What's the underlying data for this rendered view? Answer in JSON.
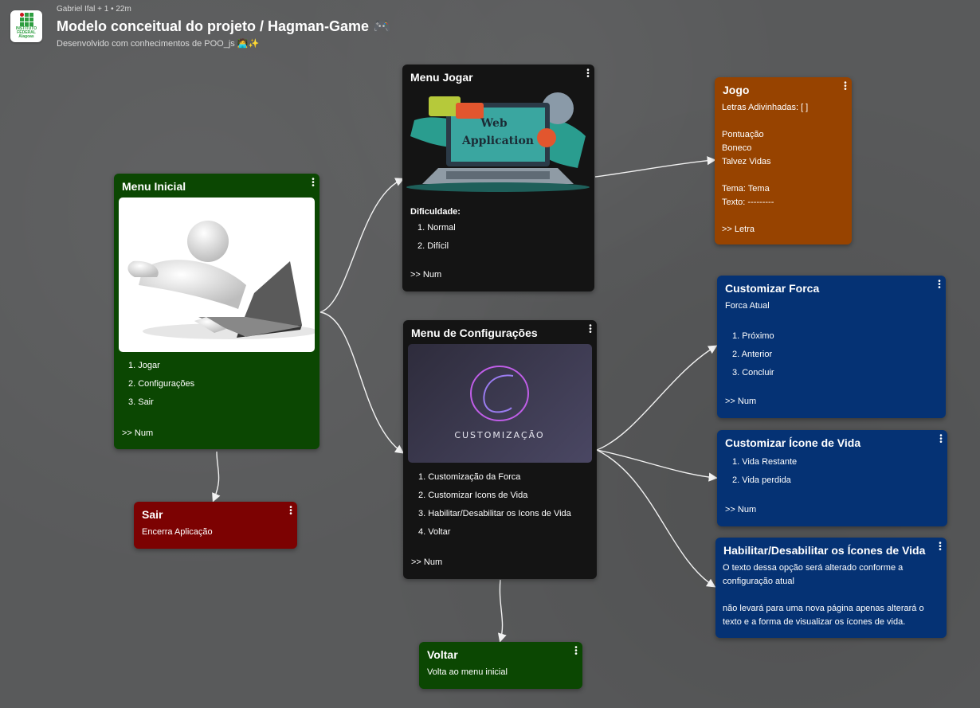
{
  "header": {
    "meta": "Gabriel Ifal + 1 •  22m",
    "title": "Modelo conceitual do projeto / Hagman-Game 🎮",
    "subtitle": "Desenvolvido com conhecimentos de POO_js 🧑‍💻✨",
    "logo_text": "INSTITUTO FEDERAL Alagoas"
  },
  "menu_inicial": {
    "title": "Menu Inicial",
    "items": [
      "1. Jogar",
      "2. Configurações",
      "3. Sair"
    ],
    "footer": ">> Num"
  },
  "sair": {
    "title": "Sair",
    "text": "Encerra Aplicação"
  },
  "menu_jogar": {
    "title": "Menu Jogar",
    "image_text_1": "Web",
    "image_text_2": "Application",
    "label": "Dificuldade:",
    "items": [
      "1. Normal",
      "2. Difícil"
    ],
    "footer": ">> Num"
  },
  "menu_config": {
    "title": "Menu de Configurações",
    "image_text": "CUSTOMIZAÇÃO",
    "items": [
      "1. Customização da Forca",
      "2. Customizar Icons de Vida",
      "3. Habilitar/Desabilitar os Icons de Vida",
      "4. Voltar"
    ],
    "footer": ">> Num"
  },
  "voltar": {
    "title": "Voltar",
    "text": "Volta ao menu inicial"
  },
  "jogo": {
    "title": "Jogo",
    "lines": [
      "Letras Adivinhadas: [ ]",
      "",
      "Pontuação",
      "Boneco",
      "Talvez Vidas",
      "",
      "Tema: Tema",
      "Texto: ---------",
      "",
      ">> Letra"
    ]
  },
  "customizar_forca": {
    "title": "Customizar Forca",
    "subtitle": "Forca Atual",
    "items": [
      "1. Próximo",
      "2. Anterior",
      "3. Concluir"
    ],
    "footer": ">> Num"
  },
  "customizar_icone": {
    "title": "Customizar Ícone de Vida",
    "items": [
      "1. Vida Restante",
      "2. Vida perdida"
    ],
    "footer": ">> Num"
  },
  "habilitar": {
    "title": "Habilitar/Desabilitar os Ícones de Vida",
    "lines": [
      "O texto dessa opção será alterado conforme a",
      "configuração atual",
      "",
      "não levará para uma nova página apenas alterará o",
      "texto e a forma de visualizar os ícones de vida."
    ]
  },
  "colors": {
    "green": "#0b4702",
    "dark": "#141414",
    "orange": "#974300",
    "blue": "#053274",
    "red": "#7c0202",
    "board": "#595a5b"
  },
  "icons": [
    "menu-dots-icon",
    "arrow-icon",
    "logo-icon"
  ]
}
